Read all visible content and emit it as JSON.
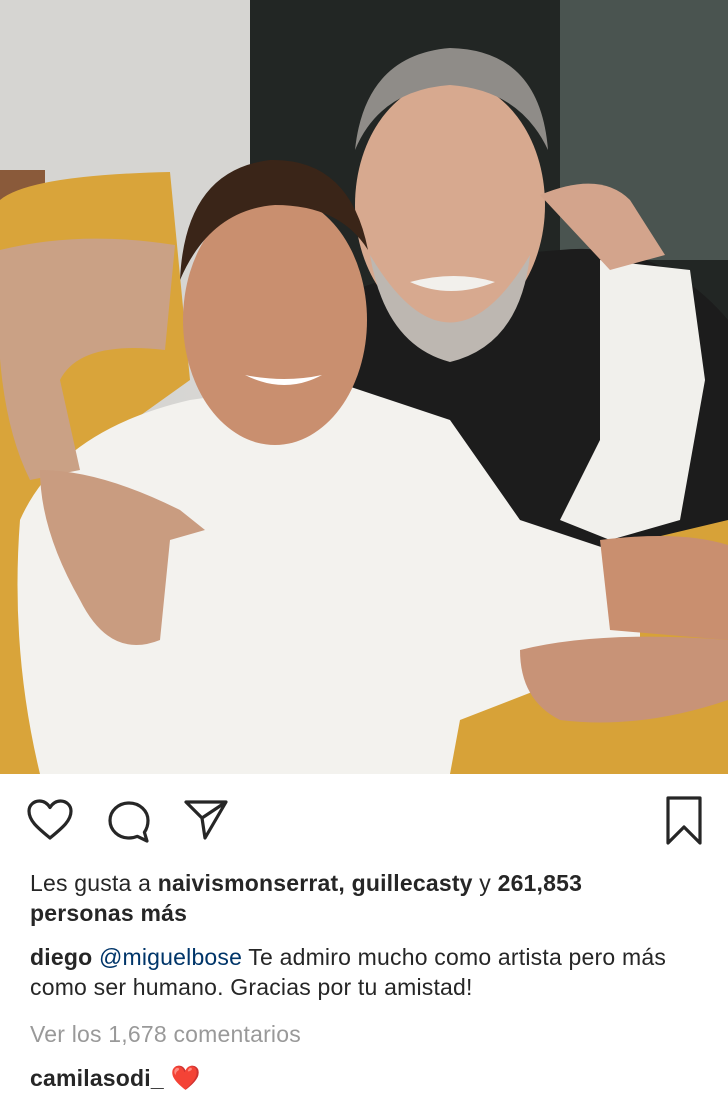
{
  "post": {
    "photo_alt_icon": "photo-two-men-embracing",
    "actions": {
      "like_icon": "heart-outline-icon",
      "comment_icon": "comment-bubble-icon",
      "share_icon": "paper-plane-icon",
      "save_icon": "bookmark-icon"
    },
    "likes": {
      "prefix": "Les gusta a ",
      "users": "naivismonserrat, guillecasty",
      "connector": " y ",
      "count": "261,853",
      "suffix": "personas más"
    },
    "caption": {
      "username": "diego",
      "mention": "@miguelbose",
      "text": " Te admiro mucho como artista pero más como ser humano. Gracias por tu amistad!"
    },
    "view_comments": "Ver los 1,678 comentarios",
    "comments": [
      {
        "username": "camilasodi_",
        "text": "❤️"
      }
    ],
    "colors": {
      "text": "#262626",
      "muted": "#999999",
      "mention": "#003569",
      "sofa": "#d9a43a"
    }
  }
}
